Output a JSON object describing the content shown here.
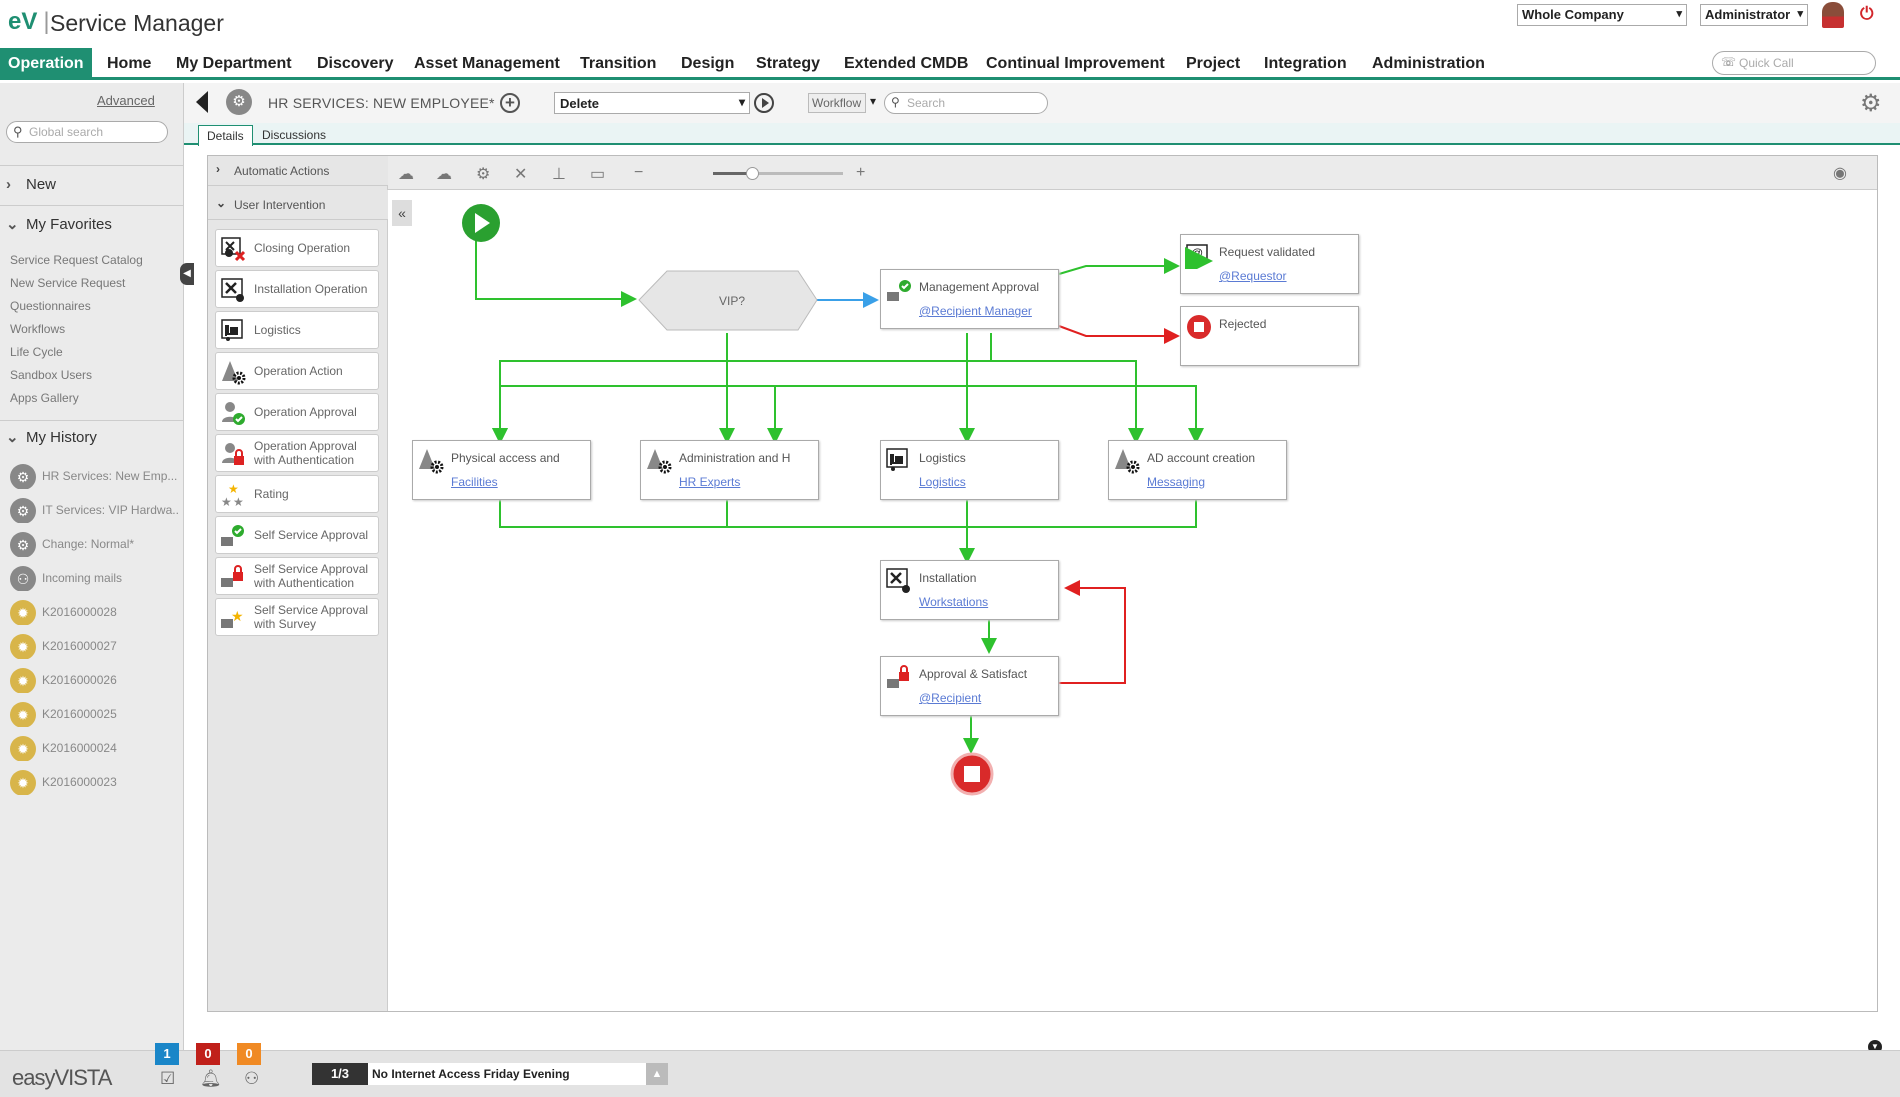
{
  "header": {
    "logo_text": "eV",
    "app_title": "Service Manager",
    "company_select": "Whole Company",
    "role_select": "Administrator"
  },
  "nav": {
    "items": [
      "Operation",
      "Home",
      "My Department",
      "Discovery",
      "Asset Management",
      "Transition",
      "Design",
      "Strategy",
      "Extended CMDB",
      "Continual Improvement",
      "Project",
      "Integration",
      "Administration"
    ],
    "quick_call_placeholder": "Quick Call"
  },
  "sidebar": {
    "advanced_link": "Advanced",
    "search_placeholder": "Global search",
    "new_label": "New",
    "favorites_label": "My Favorites",
    "favorites": [
      "Service Request Catalog",
      "New Service Request",
      "Questionnaires",
      "Workflows",
      "Life Cycle",
      "Sandbox Users",
      "Apps Gallery"
    ],
    "history_label": "My History",
    "history": [
      {
        "label": "HR Services: New Emp...",
        "icon": "gear-icon"
      },
      {
        "label": "IT Services: VIP Hardwa...",
        "icon": "gear-icon"
      },
      {
        "label": "Change: Normal*",
        "icon": "gear-icon"
      },
      {
        "label": "Incoming mails",
        "icon": "sitemap-icon"
      },
      {
        "label": "K2016000028",
        "icon": "lightbulb-icon"
      },
      {
        "label": "K2016000027",
        "icon": "lightbulb-icon"
      },
      {
        "label": "K2016000026",
        "icon": "lightbulb-icon"
      },
      {
        "label": "K2016000025",
        "icon": "lightbulb-icon"
      },
      {
        "label": "K2016000024",
        "icon": "lightbulb-icon"
      },
      {
        "label": "K2016000023",
        "icon": "lightbulb-icon"
      }
    ]
  },
  "toolbar": {
    "record_title": "HR SERVICES: NEW EMPLOYEE*",
    "action_select": "Delete",
    "workflow_select": "Workflow",
    "search_placeholder": "Search"
  },
  "tabs": [
    "Details",
    "Discussions"
  ],
  "palette": {
    "automatic_actions": "Automatic Actions",
    "user_intervention": "User Intervention",
    "items": [
      {
        "label": "Closing Operation",
        "icon": "closing-operation-icon"
      },
      {
        "label": "Installation Operation",
        "icon": "installation-icon"
      },
      {
        "label": "Logistics",
        "icon": "logistics-icon"
      },
      {
        "label": "Operation Action",
        "icon": "operation-action-icon"
      },
      {
        "label": "Operation Approval",
        "icon": "operation-approval-icon"
      },
      {
        "label": "Operation Approval with Authentication",
        "icon": "approval-lock-icon"
      },
      {
        "label": "Rating",
        "icon": "rating-stars-icon"
      },
      {
        "label": "Self Service Approval",
        "icon": "self-service-approval-icon"
      },
      {
        "label": "Self Service Approval with Authentication",
        "icon": "self-service-lock-icon"
      },
      {
        "label": "Self Service Approval with Survey",
        "icon": "self-service-survey-icon"
      }
    ]
  },
  "canvas": {
    "zoom_level": 0.3
  },
  "diagram": {
    "vip_label": "VIP?",
    "nodes": [
      {
        "title": "Management Approval",
        "sub": "@Recipient Manager"
      },
      {
        "title": "Request validated",
        "sub": "@Requestor"
      },
      {
        "title": "Rejected",
        "sub": ""
      },
      {
        "title": "Physical access and",
        "sub": "Facilities"
      },
      {
        "title": "Administration and H",
        "sub": "HR Experts"
      },
      {
        "title": "Logistics",
        "sub": "Logistics"
      },
      {
        "title": "AD account creation",
        "sub": "Messaging"
      },
      {
        "title": "Installation",
        "sub": "Workstations"
      },
      {
        "title": "Approval & Satisfact",
        "sub": "@Recipient"
      }
    ]
  },
  "statusbar": {
    "brand": "easyVISTA",
    "badges": [
      {
        "value": "1",
        "color": "#1a86c8"
      },
      {
        "value": "0",
        "color": "#c0201a"
      },
      {
        "value": "0",
        "color": "#f08a24"
      }
    ],
    "message_pager": "1/3",
    "message_text": "No Internet Access Friday Evening"
  },
  "colors": {
    "accent": "#1f8f72",
    "flow_green": "#2ec12e",
    "flow_red": "#e02020",
    "flow_blue": "#3aa0e8"
  }
}
